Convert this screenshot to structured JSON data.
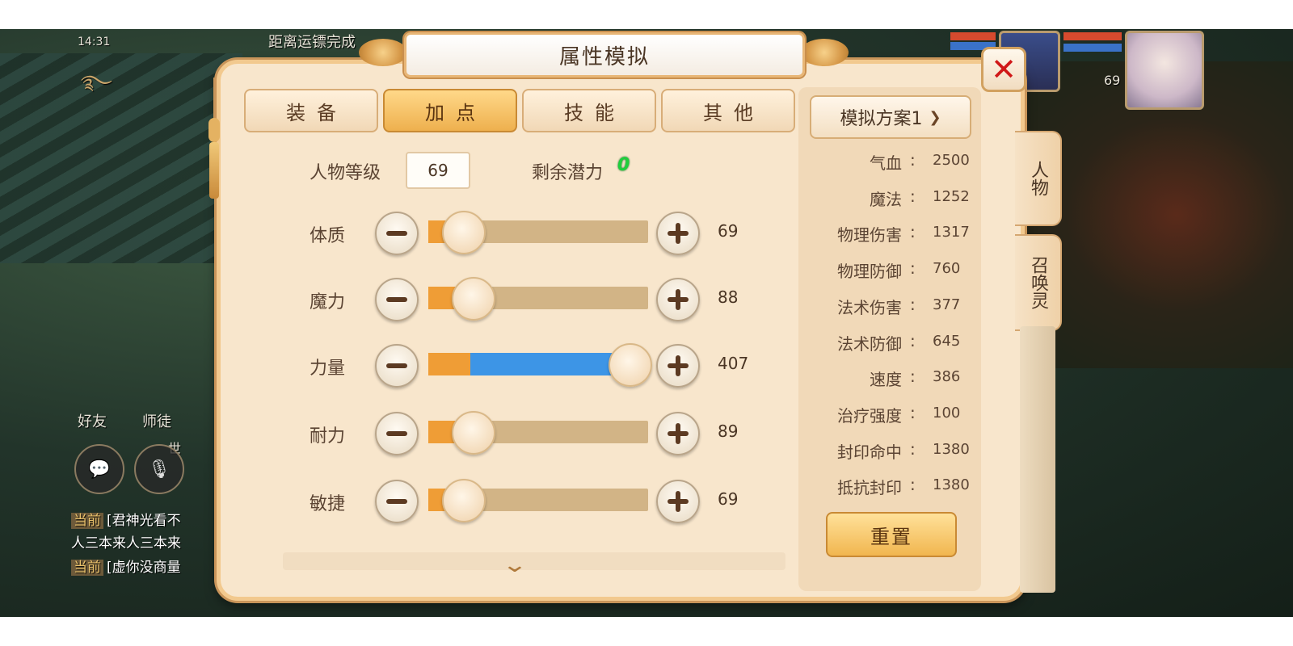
{
  "game": {
    "status_time": "14:31",
    "top_notice": "距离运镖完成",
    "player_level": "69",
    "friends_label": "好友",
    "master_label": "师徒",
    "world_label": "世",
    "chat": [
      {
        "channel": "当前",
        "text": "[君神光看不"
      },
      {
        "channel": "",
        "text": "人三本来人三本来"
      },
      {
        "channel": "当前",
        "text": "[虚你没商量"
      }
    ]
  },
  "dialog": {
    "title": "属性模拟",
    "close_icon": "close-x-icon",
    "tabs": [
      {
        "label": "装备",
        "active": false
      },
      {
        "label": "加点",
        "active": true
      },
      {
        "label": "技能",
        "active": false
      },
      {
        "label": "其他",
        "active": false
      }
    ],
    "level_label": "人物等级",
    "level_value": "69",
    "potential_label": "剩余潜力",
    "potential_value": "0",
    "stats": [
      {
        "name": "体质",
        "value": "69",
        "base_fraction": 0.0,
        "added_fraction": 0.0
      },
      {
        "name": "魔力",
        "value": "88",
        "base_fraction": 0.15,
        "added_fraction": 0.0
      },
      {
        "name": "力量",
        "value": "407",
        "base_fraction": 0.2,
        "added_fraction": 0.8
      },
      {
        "name": "耐力",
        "value": "89",
        "base_fraction": 0.15,
        "added_fraction": 0.0
      },
      {
        "name": "敏捷",
        "value": "69",
        "base_fraction": 0.0,
        "added_fraction": 0.0
      }
    ],
    "scheme_label": "模拟方案1",
    "attributes": [
      {
        "name": "气血",
        "value": "2500"
      },
      {
        "name": "魔法",
        "value": "1252"
      },
      {
        "name": "物理伤害",
        "value": "1317"
      },
      {
        "name": "物理防御",
        "value": "760"
      },
      {
        "name": "法术伤害",
        "value": "377"
      },
      {
        "name": "法术防御",
        "value": "645"
      },
      {
        "name": "速度",
        "value": "386"
      },
      {
        "name": "治疗强度",
        "value": "100"
      },
      {
        "name": "封印命中",
        "value": "1380"
      },
      {
        "name": "抵抗封印",
        "value": "1380"
      }
    ],
    "attr_colon": ":",
    "reset_label": "重置",
    "side_tabs": [
      {
        "label": "人物"
      },
      {
        "label": "召唤灵"
      }
    ],
    "colors": {
      "base_fill": "#ef9d36",
      "added_fill": "#3d95e6",
      "potential": "#1fcf3c"
    }
  }
}
